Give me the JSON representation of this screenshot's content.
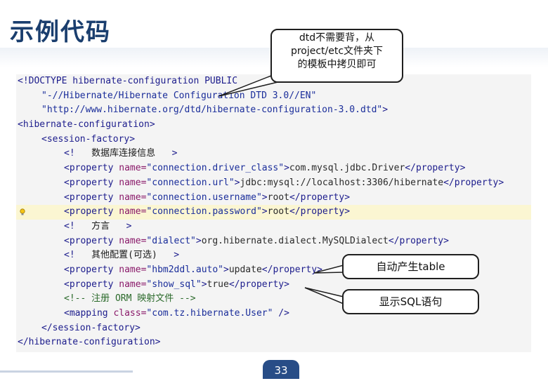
{
  "slide": {
    "title": "示例代码",
    "page_number": "33"
  },
  "callouts": {
    "dtd_note": [
      "dtd不需要背，从",
      "project/etc文件夹下",
      "的模板中拷贝即可"
    ],
    "hbm2ddl_note": "自动产生table",
    "show_sql_note": "显示SQL语句"
  },
  "code": {
    "highlighted_line": 9,
    "lines": [
      {
        "indent": 0,
        "tokens": [
          [
            "tag",
            "<!DOCTYPE hibernate-configuration PUBLIC"
          ]
        ]
      },
      {
        "indent": 1,
        "tokens": [
          [
            "str",
            "\"-//Hibernate/Hibernate Configuration DTD 3.0//EN\""
          ]
        ]
      },
      {
        "indent": 1,
        "tokens": [
          [
            "str",
            "\"http://www.hibernate.org/dtd/hibernate-configuration-3.0.dtd\""
          ],
          [
            "tag",
            ">"
          ]
        ]
      },
      {
        "indent": 0,
        "tokens": [
          [
            "tag",
            "<hibernate-configuration>"
          ]
        ]
      },
      {
        "indent": 1,
        "tokens": [
          [
            "tag",
            "<session-factory>"
          ]
        ]
      },
      {
        "indent": 2,
        "tokens": [
          [
            "tag",
            "<!"
          ],
          [
            "cn",
            "   数据库连接信息   "
          ],
          [
            "tag",
            ">"
          ]
        ]
      },
      {
        "indent": 2,
        "tokens": [
          [
            "tag",
            "<property "
          ],
          [
            "attr",
            "name="
          ],
          [
            "str",
            "\"connection.driver_class\""
          ],
          [
            "tag",
            ">"
          ],
          [
            "text",
            "com.mysql.jdbc.Driver"
          ],
          [
            "tag",
            "</property>"
          ]
        ]
      },
      {
        "indent": 2,
        "tokens": [
          [
            "tag",
            "<property "
          ],
          [
            "attr",
            "name="
          ],
          [
            "str",
            "\"connection.url\""
          ],
          [
            "tag",
            ">"
          ],
          [
            "text",
            "jdbc:mysql://localhost:3306/hibernate"
          ],
          [
            "tag",
            "</property>"
          ]
        ]
      },
      {
        "indent": 2,
        "tokens": [
          [
            "tag",
            "<property "
          ],
          [
            "attr",
            "name="
          ],
          [
            "str",
            "\"connection.username\""
          ],
          [
            "tag",
            ">"
          ],
          [
            "text",
            "root"
          ],
          [
            "tag",
            "</property>"
          ]
        ]
      },
      {
        "indent": 2,
        "tokens": [
          [
            "tag",
            "<property "
          ],
          [
            "attr",
            "name="
          ],
          [
            "str",
            "\"connection.password\""
          ],
          [
            "tag",
            ">"
          ],
          [
            "text",
            "root"
          ],
          [
            "tag",
            "</property>"
          ]
        ]
      },
      {
        "indent": 2,
        "tokens": [
          [
            "tag",
            "<!"
          ],
          [
            "cn",
            "   方言   "
          ],
          [
            "tag",
            ">"
          ]
        ]
      },
      {
        "indent": 2,
        "tokens": [
          [
            "tag",
            "<property "
          ],
          [
            "attr",
            "name="
          ],
          [
            "str",
            "\"dialect\""
          ],
          [
            "tag",
            ">"
          ],
          [
            "text",
            "org.hibernate.dialect.MySQLDialect"
          ],
          [
            "tag",
            "</property>"
          ]
        ]
      },
      {
        "indent": 2,
        "tokens": [
          [
            "tag",
            "<!"
          ],
          [
            "cn",
            "   其他配置(可选)   "
          ],
          [
            "tag",
            ">"
          ]
        ]
      },
      {
        "indent": 2,
        "tokens": [
          [
            "tag",
            "<property "
          ],
          [
            "attr",
            "name="
          ],
          [
            "str",
            "\"hbm2ddl.auto\""
          ],
          [
            "tag",
            ">"
          ],
          [
            "text",
            "update"
          ],
          [
            "tag",
            "</property>"
          ]
        ]
      },
      {
        "indent": 2,
        "tokens": [
          [
            "tag",
            "<property "
          ],
          [
            "attr",
            "name="
          ],
          [
            "str",
            "\"show_sql\""
          ],
          [
            "tag",
            ">"
          ],
          [
            "text",
            "true"
          ],
          [
            "tag",
            "</property>"
          ]
        ]
      },
      {
        "indent": 2,
        "tokens": [
          [
            "com",
            "<!-- 注册 ORM 映射文件 -->"
          ]
        ]
      },
      {
        "indent": 2,
        "tokens": [
          [
            "tag",
            "<mapping "
          ],
          [
            "attr",
            "class="
          ],
          [
            "str",
            "\"com.tz.hibernate.User\""
          ],
          [
            "tag",
            " />"
          ]
        ]
      },
      {
        "indent": 1,
        "tokens": [
          [
            "tag",
            "</session-factory>"
          ]
        ]
      },
      {
        "indent": 0,
        "tokens": [
          [
            "tag",
            "</hibernate-configuration>"
          ]
        ]
      }
    ]
  },
  "colors": {
    "title": "#1a3e6e",
    "page_badge": "#284d87",
    "code_background": "#f4f4f4",
    "highlight_line": "#fbf6d2"
  },
  "icons": {
    "gutter_marker": "lightbulb-icon"
  }
}
